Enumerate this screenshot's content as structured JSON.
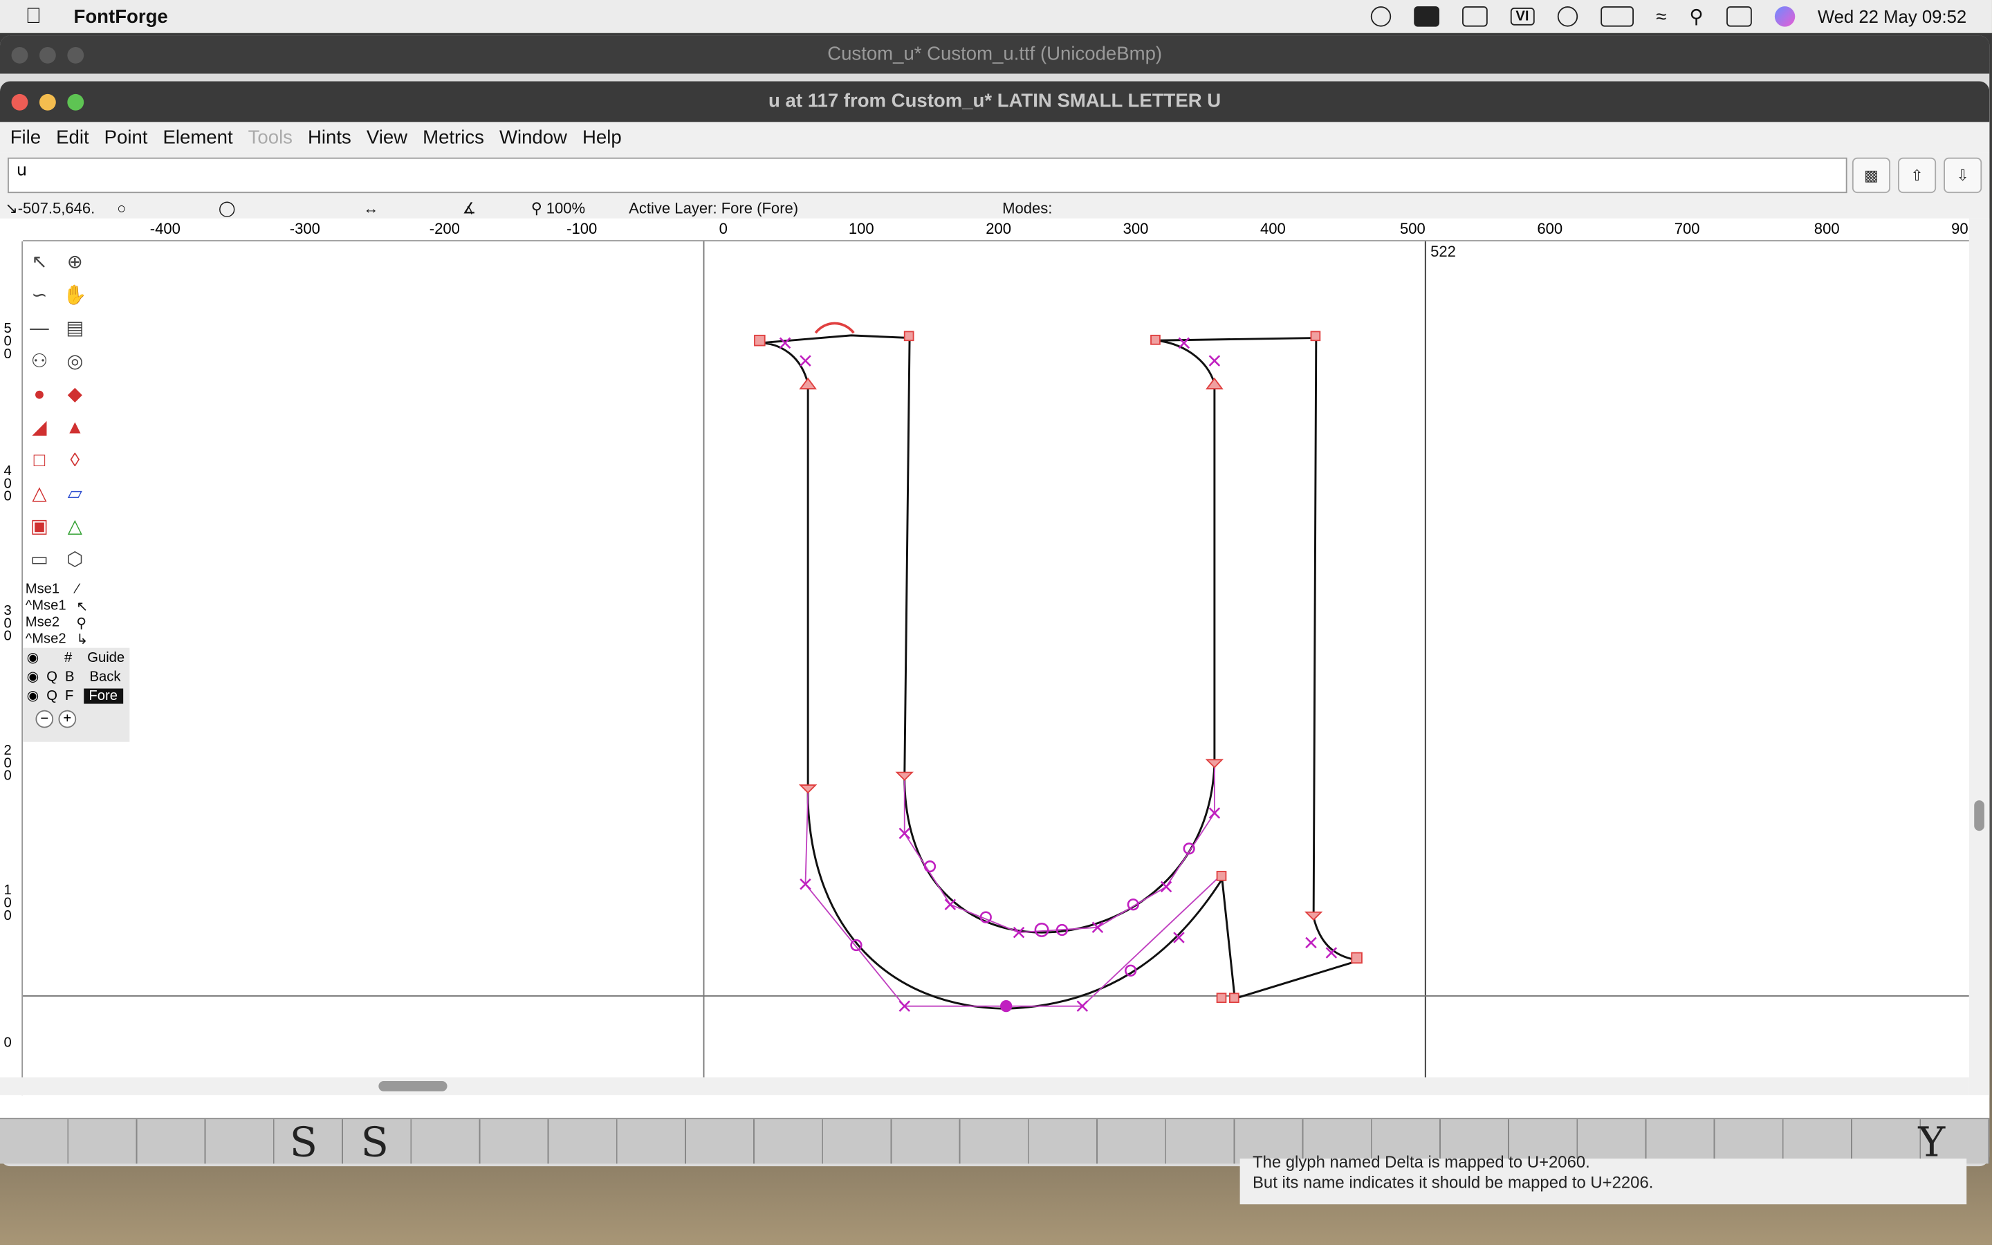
{
  "menubar": {
    "app_name": "FontForge",
    "clock": "Wed 22 May  09:52",
    "status_icons": [
      "shield-icon",
      "drive-icon",
      "display-icon",
      "vi-icon",
      "play-icon",
      "battery-icon",
      "wifi-icon",
      "search-icon",
      "control-center-icon",
      "siri-icon"
    ],
    "vi_label": "VI"
  },
  "font_window": {
    "title": "Custom_u*  Custom_u.ttf (UnicodeBmp)",
    "strip_chars": [
      "S",
      "S",
      "Y"
    ]
  },
  "glyph_window": {
    "title": "u at 117 from Custom_u* LATIN SMALL LETTER U",
    "menu": [
      "File",
      "Edit",
      "Point",
      "Element",
      "Tools",
      "Hints",
      "View",
      "Metrics",
      "Window",
      "Help"
    ],
    "char_field_value": "u",
    "info": {
      "coords": "-507.5,646.",
      "zoom": "100%",
      "active_layer": "Active Layer: Fore (Fore)",
      "modes": "Modes:"
    },
    "ruler_labels": [
      "-400",
      "-300",
      "-200",
      "-100",
      "0",
      "100",
      "200",
      "300",
      "400",
      "500",
      "600",
      "700",
      "800",
      "90"
    ],
    "vruler_labels": [
      "500",
      "400",
      "300",
      "200",
      "100",
      "0"
    ],
    "advance_width": "522",
    "mouse_bindings": [
      "Mse1",
      "^Mse1",
      "Mse2",
      "^Mse2"
    ],
    "layers": [
      {
        "q": "",
        "t": "#",
        "name": "Guide"
      },
      {
        "q": "Q",
        "t": "B",
        "name": "Back"
      },
      {
        "q": "Q",
        "t": "F",
        "name": "Fore"
      }
    ]
  },
  "notice": {
    "line1": "The glyph named Delta is mapped to U+2060.",
    "line2": "But its name indicates it should be mapped to U+2206."
  }
}
